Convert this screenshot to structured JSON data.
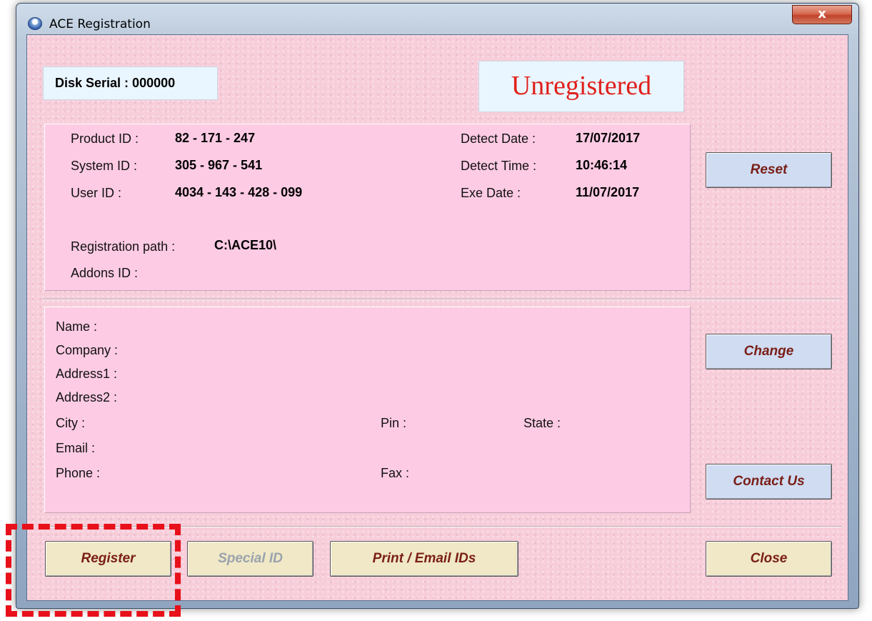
{
  "window": {
    "title": "ACE Registration",
    "close_glyph": "x"
  },
  "header": {
    "disk_serial": "Disk Serial : 000000",
    "status": "Unregistered"
  },
  "ids": {
    "product_id_label": "Product ID :",
    "product_id": "82 - 171 - 247",
    "system_id_label": "System ID :",
    "system_id": "305 - 967 - 541",
    "user_id_label": "User ID :",
    "user_id": "4034 - 143 - 428 - 099",
    "detect_date_label": "Detect Date :",
    "detect_date": "17/07/2017",
    "detect_time_label": "Detect Time :",
    "detect_time": "10:46:14",
    "exe_date_label": "Exe Date :",
    "exe_date": "11/07/2017",
    "registration_path_label": "Registration path :",
    "registration_path": "C:\\ACE10\\",
    "addons_id_label": "Addons ID :"
  },
  "contact": {
    "name_label": "Name :",
    "company_label": "Company :",
    "address1_label": "Address1 :",
    "address2_label": "Address2 :",
    "city_label": "City :",
    "pin_label": "Pin :",
    "state_label": "State :",
    "email_label": "Email :",
    "phone_label": "Phone :",
    "fax_label": "Fax :"
  },
  "buttons": {
    "reset": "Reset",
    "change": "Change",
    "contact_us": "Contact Us",
    "register": "Register",
    "special_id": "Special ID",
    "print_email_ids": "Print / Email IDs",
    "close": "Close"
  },
  "colors": {
    "status_text": "#e0201c",
    "button_text": "#7a1e16",
    "panel": "#fdcbe4",
    "highlight": "#e8101a"
  }
}
